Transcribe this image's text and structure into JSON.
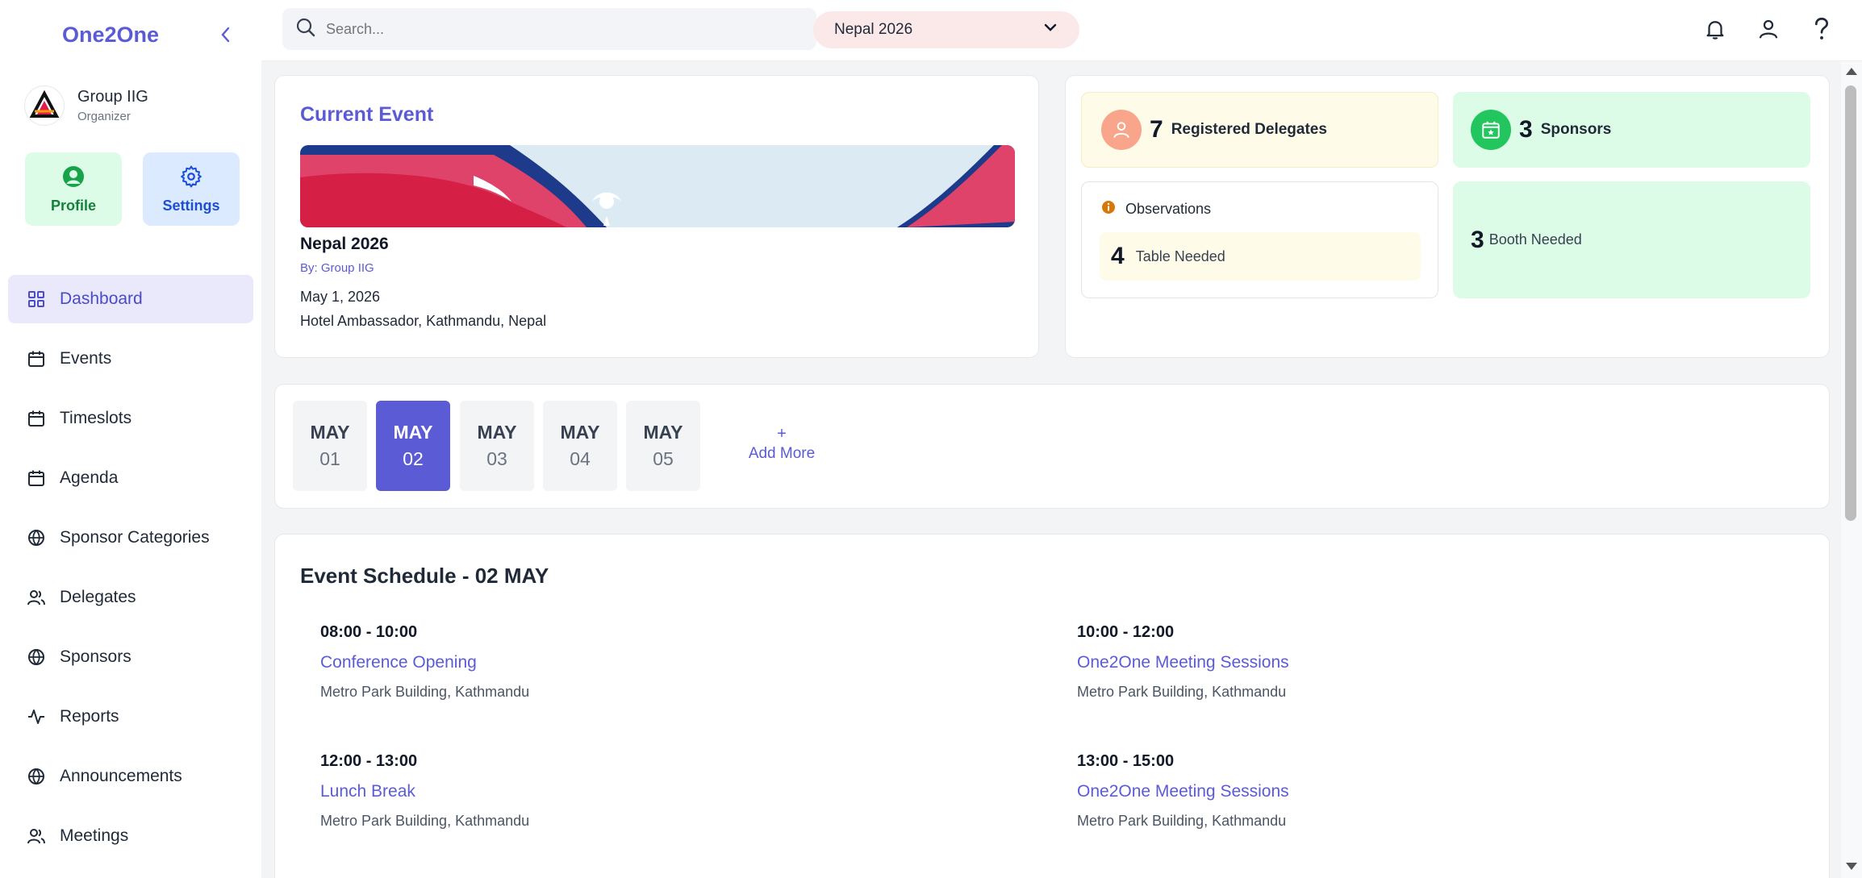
{
  "brand": "One2One",
  "organizer": {
    "name": "Group IIG",
    "role": "Organizer"
  },
  "quick_actions": {
    "profile": "Profile",
    "settings": "Settings"
  },
  "nav": [
    {
      "label": "Dashboard",
      "icon": "grid-icon",
      "active": true
    },
    {
      "label": "Events",
      "icon": "calendar-icon"
    },
    {
      "label": "Timeslots",
      "icon": "calendar-icon"
    },
    {
      "label": "Agenda",
      "icon": "calendar-icon"
    },
    {
      "label": "Sponsor Categories",
      "icon": "globe-icon"
    },
    {
      "label": "Delegates",
      "icon": "users-icon"
    },
    {
      "label": "Sponsors",
      "icon": "globe-icon"
    },
    {
      "label": "Reports",
      "icon": "activity-icon"
    },
    {
      "label": "Announcements",
      "icon": "globe-icon"
    },
    {
      "label": "Meetings",
      "icon": "users-icon"
    }
  ],
  "topbar": {
    "search_placeholder": "Search...",
    "event_selected": "Nepal 2026"
  },
  "current_event": {
    "heading": "Current Event",
    "name": "Nepal 2026",
    "by": "By: Group IIG",
    "date": "May 1, 2026",
    "venue": "Hotel Ambassador, Kathmandu, Nepal"
  },
  "stats": {
    "delegates": {
      "count": "7",
      "label": "Registered Delegates"
    },
    "sponsors": {
      "count": "3",
      "label": "Sponsors"
    },
    "observations": {
      "label": "Observations",
      "count": "4",
      "item": "Table Needed"
    },
    "booth": {
      "count": "3",
      "label": "Booth Needed"
    }
  },
  "dates": [
    {
      "month": "MAY",
      "day": "01"
    },
    {
      "month": "MAY",
      "day": "02",
      "active": true
    },
    {
      "month": "MAY",
      "day": "03"
    },
    {
      "month": "MAY",
      "day": "04"
    },
    {
      "month": "MAY",
      "day": "05"
    }
  ],
  "add_more": {
    "plus": "+",
    "label": "Add More"
  },
  "schedule": {
    "title": "Event Schedule - 02 MAY",
    "slots": [
      {
        "time": "08:00 - 10:00",
        "name": "Conference Opening",
        "location": "Metro Park Building, Kathmandu"
      },
      {
        "time": "10:00 - 12:00",
        "name": "One2One Meeting Sessions",
        "location": "Metro Park Building, Kathmandu"
      },
      {
        "time": "12:00 - 13:00",
        "name": "Lunch Break",
        "location": "Metro Park Building, Kathmandu"
      },
      {
        "time": "13:00 - 15:00",
        "name": "One2One Meeting Sessions",
        "location": "Metro Park Building, Kathmandu"
      }
    ]
  },
  "colors": {
    "accent": "#5b5bd6",
    "flag_red": "#dc143c",
    "flag_blue": "#003893"
  }
}
